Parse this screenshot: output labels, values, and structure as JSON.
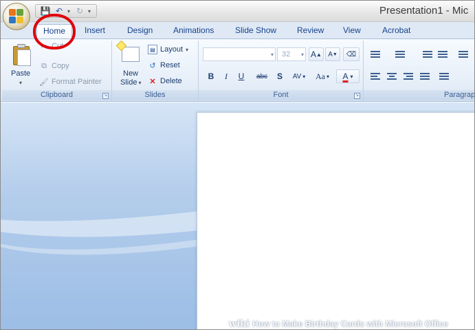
{
  "window": {
    "title": "Presentation1 - Mic"
  },
  "quick_access": {
    "items": [
      "save-icon",
      "undo-icon",
      "redo-icon",
      "customize-icon"
    ]
  },
  "tabs": [
    {
      "label": "Home",
      "active": true
    },
    {
      "label": "Insert"
    },
    {
      "label": "Design"
    },
    {
      "label": "Animations"
    },
    {
      "label": "Slide Show"
    },
    {
      "label": "Review"
    },
    {
      "label": "View"
    },
    {
      "label": "Acrobat"
    }
  ],
  "clipboard": {
    "label": "Clipboard",
    "paste": "Paste",
    "cut": "Cut",
    "copy": "Copy",
    "format_painter": "Format Painter"
  },
  "slides": {
    "label": "Slides",
    "new_slide_line1": "New",
    "new_slide_line2": "Slide",
    "layout": "Layout",
    "reset": "Reset",
    "delete": "Delete"
  },
  "font": {
    "label": "Font",
    "size_value": "32",
    "bold": "B",
    "italic": "I",
    "underline": "U",
    "strikethrough": "abc",
    "shadow": "S",
    "spacing": "AV",
    "change_case": "Aa",
    "font_color": "A",
    "grow": "A",
    "shrink": "A"
  },
  "paragraph": {
    "label": "Paragrap"
  },
  "watermark": {
    "brand": "wiki",
    "text": "How to Make Birthday Cards with Microsoft Office"
  },
  "colors": {
    "accent": "#15428b",
    "highlight_circle": "#e0000a",
    "ribbon_bg": "#dfe9f5"
  }
}
